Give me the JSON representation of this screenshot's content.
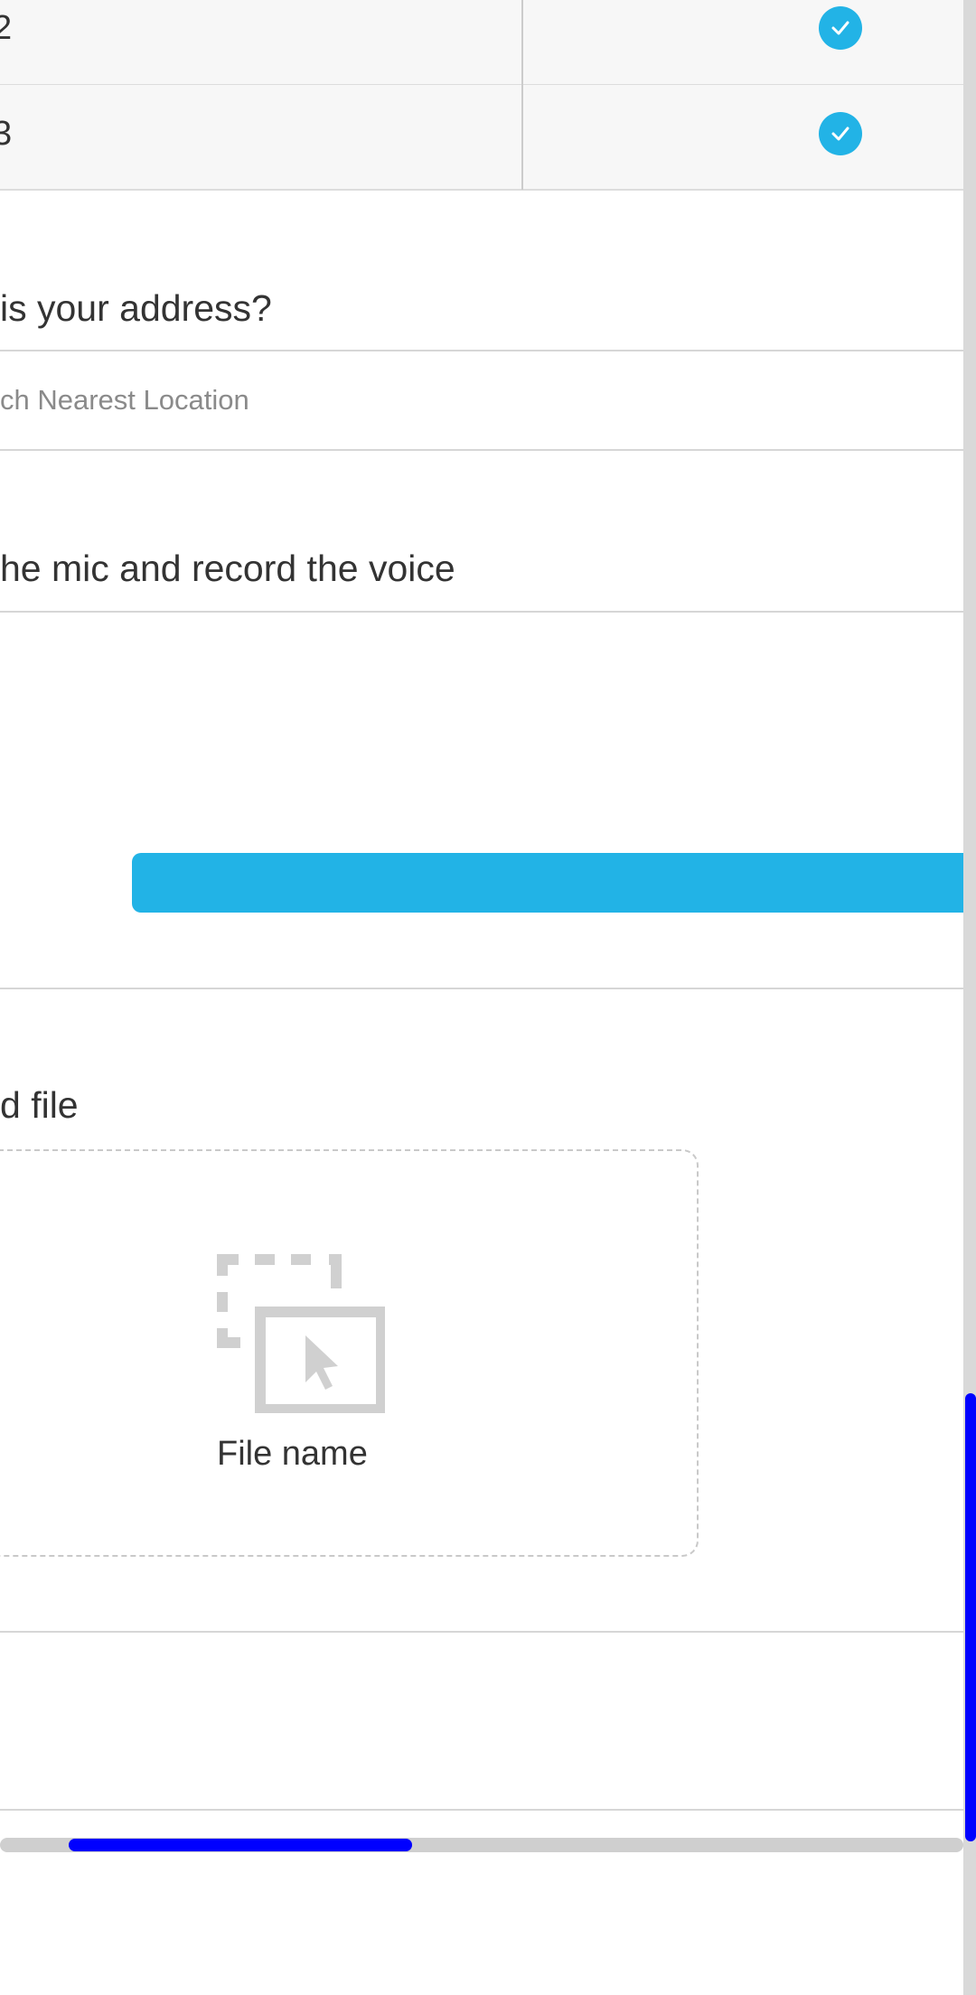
{
  "table": {
    "rows": [
      {
        "label": "2",
        "checked": true
      },
      {
        "label": "3",
        "checked": true
      }
    ]
  },
  "address": {
    "question": "is your address?",
    "placeholder": "ch Nearest Location"
  },
  "voice": {
    "question": "he mic and record the voice"
  },
  "upload": {
    "title": "d file",
    "file_name": "File name",
    "icon": "file-drop-icon"
  },
  "colors": {
    "accent": "#22b3e6",
    "scrollbar_thumb": "#0000ff"
  }
}
